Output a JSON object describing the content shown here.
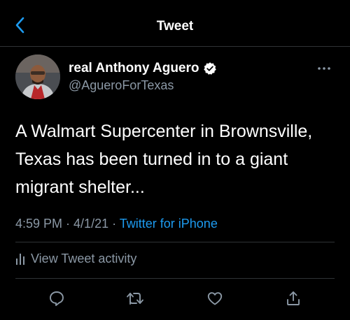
{
  "header": {
    "title": "Tweet",
    "back_icon": "chevron-left-icon"
  },
  "author": {
    "display_name": "real Anthony Aguero",
    "handle": "@AgueroForTexas",
    "verified": true
  },
  "tweet": {
    "text": "A Walmart Supercenter in Brownsville, Texas has been turned in to a giant migrant shelter...",
    "time": "4:59 PM",
    "date": "4/1/21",
    "separator": " · ",
    "source": "Twitter for iPhone"
  },
  "activity": {
    "label": "View Tweet activity",
    "icon": "bar-chart-icon"
  },
  "actions": [
    {
      "name": "reply",
      "icon": "reply-icon"
    },
    {
      "name": "retweet",
      "icon": "retweet-icon"
    },
    {
      "name": "like",
      "icon": "heart-icon"
    },
    {
      "name": "share",
      "icon": "share-icon"
    }
  ],
  "colors": {
    "background": "#000000",
    "accent": "#1d9bf0",
    "secondary_text": "#8b98a5",
    "primary_text": "#ffffff",
    "divider": "#2f3336"
  }
}
